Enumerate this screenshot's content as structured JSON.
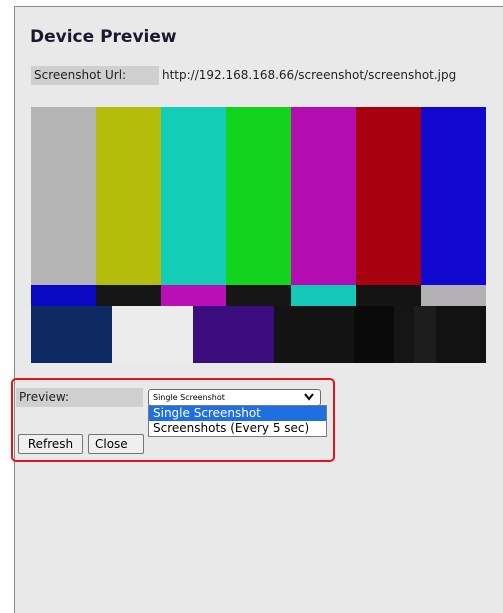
{
  "page": {
    "title": "Device Preview",
    "screenshot_url_label": "Screenshot Url:",
    "screenshot_url_value": "http://192.168.168.66/screenshot/screenshot.jpg"
  },
  "preview": {
    "label": "Preview:",
    "selected_value": "Single Screenshot",
    "options": [
      "Single Screenshot",
      "Screenshots (Every 5 sec)"
    ],
    "highlighted_option": "Single Screenshot"
  },
  "buttons": {
    "refresh_label": "Refresh",
    "close_label": "Close"
  },
  "colors": {
    "highlight_border": "#e5131b",
    "option_selected_bg": "#1e6fe0",
    "color_bars_top": [
      "#b4b4b4",
      "#b5bd0c",
      "#13cdb7",
      "#12d41c",
      "#b30cb1",
      "#a8000f",
      "#1008d1"
    ],
    "color_bars_mid": [
      "#0b08c3",
      "#151515",
      "#b80fb6",
      "#161616",
      "#13c8b6",
      "#141414",
      "#b2b0b2"
    ],
    "color_bars_bottom": [
      "#0f2a63",
      "#ececec",
      "#3b0c7e",
      "#131313",
      "#0a0a0a",
      "#151515",
      "#1d1d1d",
      "#121212"
    ]
  }
}
